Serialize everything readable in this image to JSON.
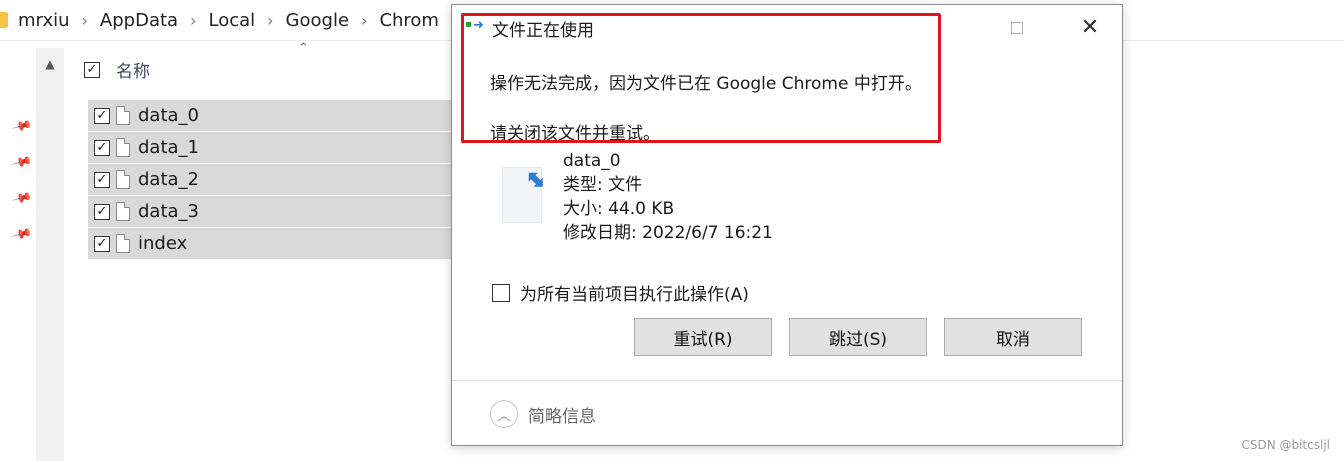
{
  "breadcrumb": [
    "mrxiu",
    "AppData",
    "Local",
    "Google",
    "Chrom"
  ],
  "file_list": {
    "header_label": "名称",
    "rows": [
      {
        "name": "data_0"
      },
      {
        "name": "data_1"
      },
      {
        "name": "data_2"
      },
      {
        "name": "data_3"
      },
      {
        "name": "index"
      }
    ]
  },
  "dialog": {
    "title": "文件正在使用",
    "message": "操作无法完成，因为文件已在 Google Chrome 中打开。",
    "instruction": "请关闭该文件并重试。",
    "file": {
      "name": "data_0",
      "type_line": "类型: 文件",
      "size_line": "大小: 44.0 KB",
      "modified_line": "修改日期: 2022/6/7 16:21"
    },
    "apply_all_label": "为所有当前项目执行此操作(A)",
    "buttons": {
      "retry": "重试(R)",
      "skip": "跳过(S)",
      "cancel": "取消"
    },
    "details_label": "简略信息",
    "highlight_color": "#e0151b"
  },
  "watermark": "CSDN @bitcsljl"
}
